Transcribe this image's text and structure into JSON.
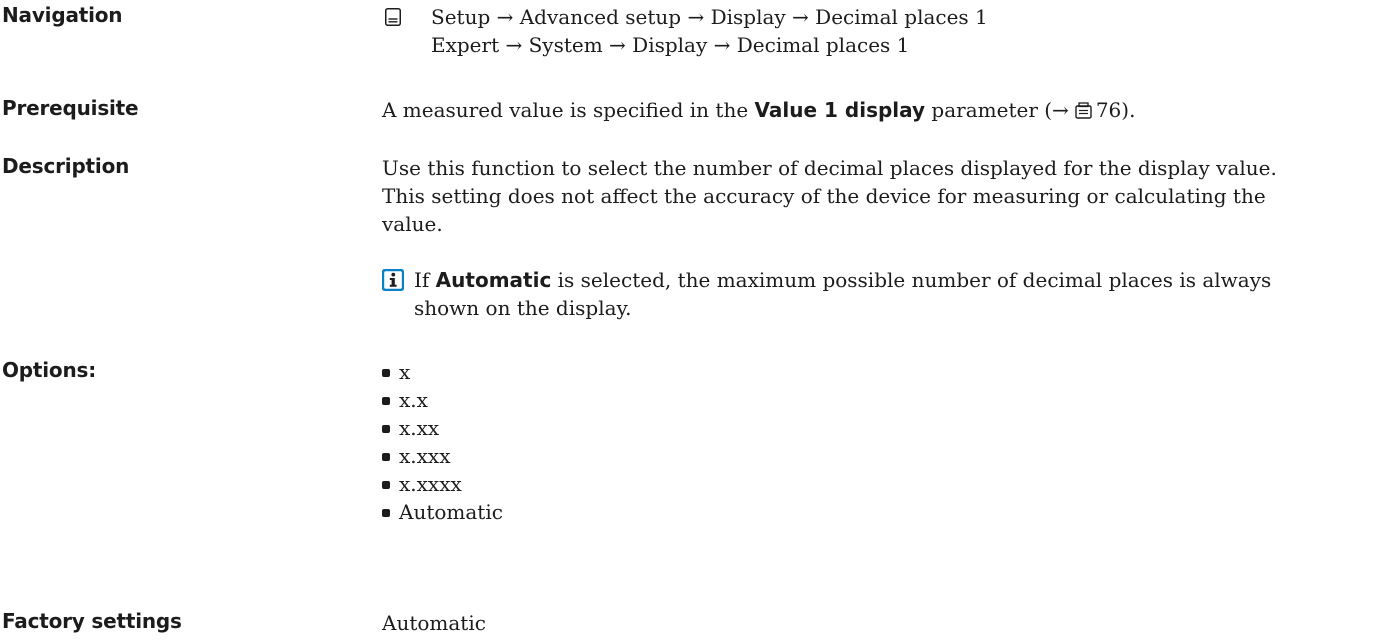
{
  "navigation": {
    "label": "Navigation",
    "icon": "display-menu-icon",
    "path1": "Setup → Advanced setup → Display → Decimal places 1",
    "path2": "Expert → System → Display → Decimal places 1"
  },
  "prerequisite": {
    "label": "Prerequisite",
    "text_before": "A measured value is specified in the ",
    "param_name": "Value 1 display",
    "text_after": " parameter (→",
    "page_ref": "76",
    "close": ")."
  },
  "description": {
    "label": "Description",
    "line1": "Use this function to select the number of decimal places displayed for the display value.",
    "line2": "This setting does not affect the accuracy of the device for measuring or calculating the",
    "line3": "value.",
    "note_prefix": "If ",
    "note_strong": "Automatic",
    "note_line1_rest": " is selected, the maximum possible number of decimal places is always",
    "note_line2": "shown on the display.",
    "info_icon_color": "#0a80c6"
  },
  "options": {
    "label": "Options:",
    "items": [
      "x",
      "x.x",
      "x.xx",
      "x.xxx",
      "x.xxxx",
      "Automatic"
    ]
  },
  "factory": {
    "label": "Factory settings",
    "value": "Automatic"
  }
}
